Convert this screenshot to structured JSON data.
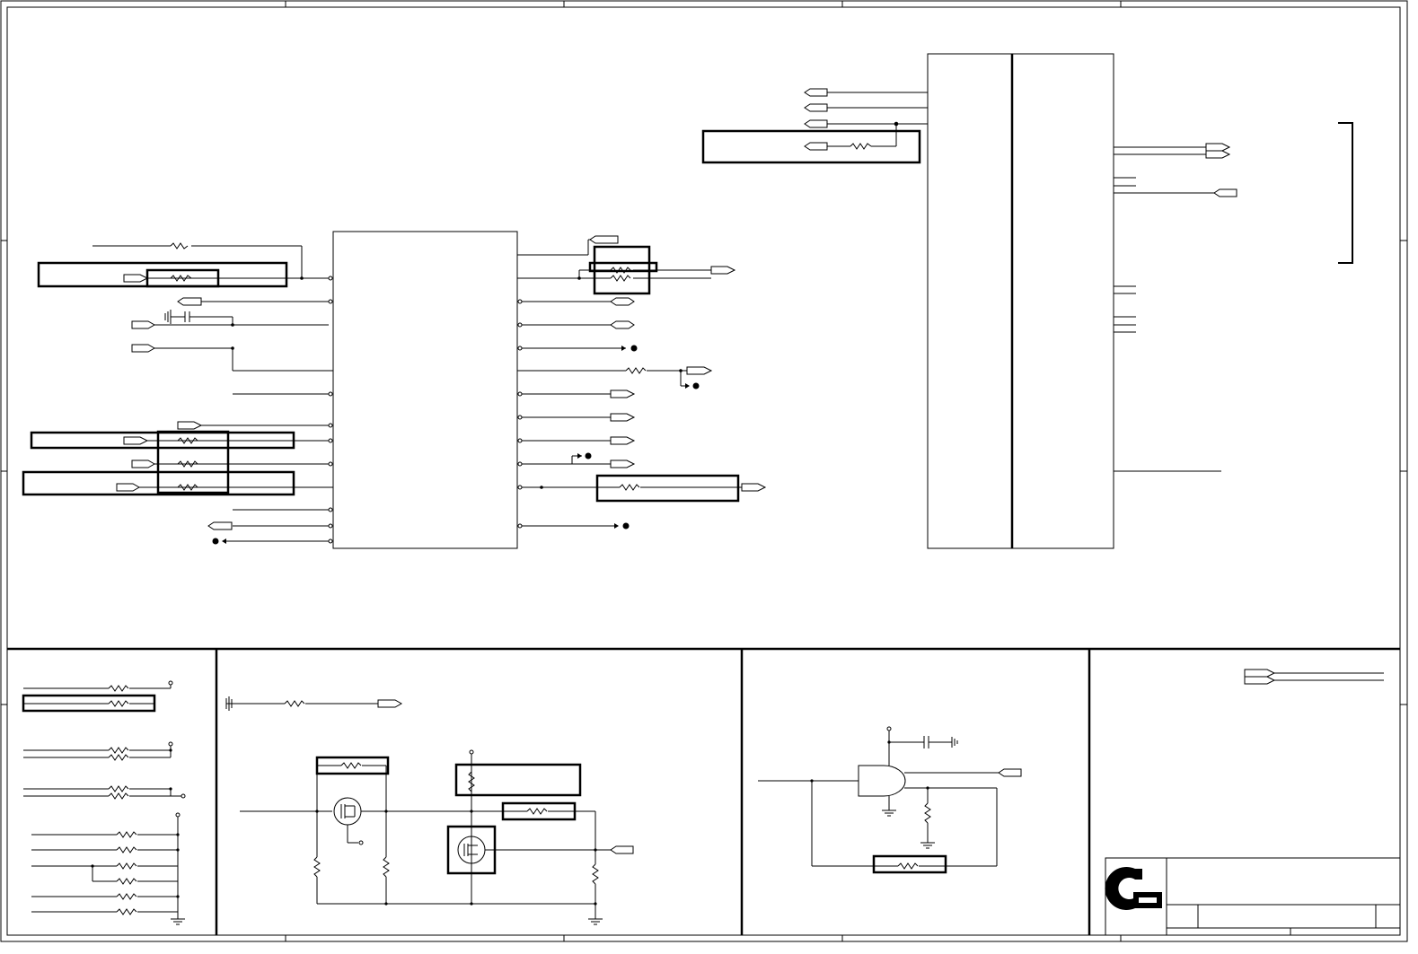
{
  "sheet": {
    "title": "",
    "company": "",
    "size": "",
    "document_number": "",
    "revision": "",
    "date": "",
    "sheet_of": ""
  },
  "colors": {
    "line": "#000000",
    "background": "#ffffff",
    "highlight_box": "#000000"
  },
  "icons": {
    "logo": "company-logo-icon",
    "ground": "ground-icon",
    "resistor": "resistor-icon",
    "capacitor": "capacitor-icon",
    "port": "port-icon",
    "mosfet": "mosfet-icon",
    "and_gate": "and-gate-icon",
    "test_point": "test-point-icon"
  }
}
